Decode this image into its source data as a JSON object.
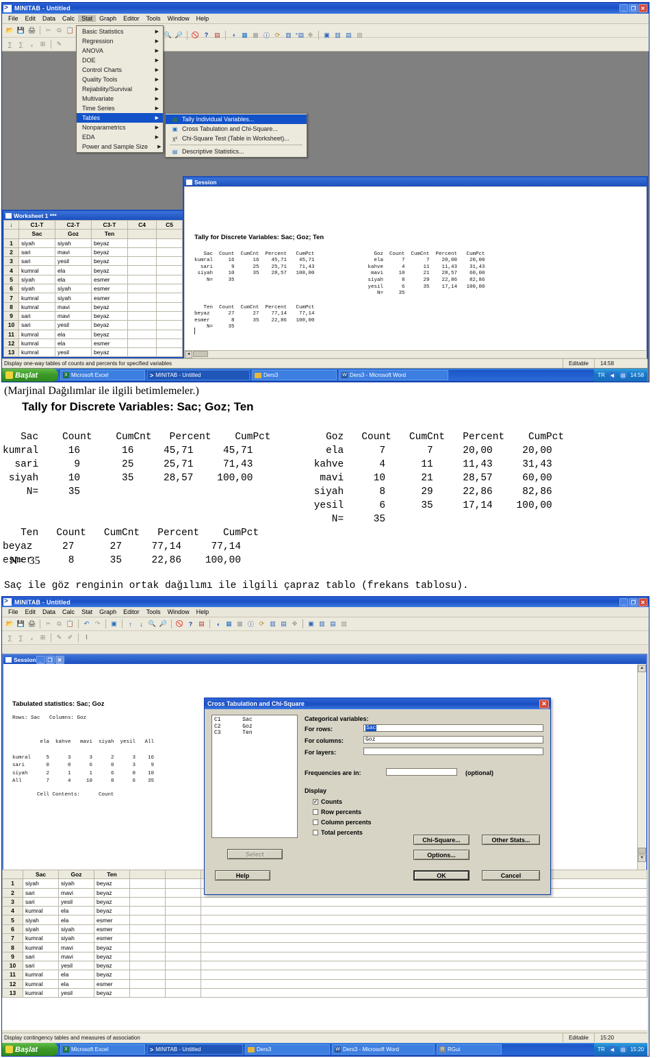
{
  "screenshot1": {
    "window": {
      "title": "MINITAB - Untitled",
      "min": "_",
      "max": "❐",
      "close": "✕"
    },
    "menubar": [
      "File",
      "Edit",
      "Data",
      "Calc",
      "Stat",
      "Graph",
      "Editor",
      "Tools",
      "Window",
      "Help"
    ],
    "stat_menu": {
      "items": [
        {
          "label": "Basic Statistics",
          "arrow": "▶"
        },
        {
          "label": "Regression",
          "arrow": "▶"
        },
        {
          "label": "ANOVA",
          "arrow": "▶"
        },
        {
          "label": "DOE",
          "arrow": "▶"
        },
        {
          "label": "Control Charts",
          "arrow": "▶"
        },
        {
          "label": "Quality Tools",
          "arrow": "▶"
        },
        {
          "label": "Rejiability/Survival",
          "arrow": "▶"
        },
        {
          "label": "Multivariate",
          "arrow": "▶"
        },
        {
          "label": "Time Series",
          "arrow": "▶"
        },
        {
          "label": "Tables",
          "arrow": "▶",
          "selected": true
        },
        {
          "label": "Nonparametrics",
          "arrow": "▶"
        },
        {
          "label": "EDA",
          "arrow": "▶"
        },
        {
          "label": "Power and Sample Size",
          "arrow": "▶"
        }
      ]
    },
    "tables_submenu": {
      "items": [
        {
          "label": "Tally Individual Variables...",
          "icon": "grid-icon",
          "selected": true
        },
        {
          "label": "Cross Tabulation and Chi-Square...",
          "icon": "crosstab-icon",
          "selected": false
        },
        {
          "label": "Chi-Square Test (Table in Worksheet)...",
          "icon": "chi-square-icon",
          "selected": false
        },
        {
          "label": "Descriptive Statistics...",
          "icon": "table-icon",
          "selected": false
        }
      ]
    },
    "session": {
      "title": "Session",
      "heading": "Tally for Discrete Variables: Sac; Goz; Ten",
      "table_sac": {
        "headers": [
          "Sac",
          "Count",
          "CumCnt",
          "Percent",
          "CumPct"
        ],
        "rows": [
          [
            "kumral",
            "16",
            "16",
            "45,71",
            "45,71"
          ],
          [
            "sari",
            "9",
            "25",
            "25,71",
            "71,43"
          ],
          [
            "siyah",
            "10",
            "35",
            "28,57",
            "100,00"
          ],
          [
            "N=",
            "35",
            "",
            "",
            ""
          ]
        ]
      },
      "table_goz": {
        "headers": [
          "Goz",
          "Count",
          "CumCnt",
          "Percent",
          "CumPct"
        ],
        "rows": [
          [
            "ela",
            "7",
            "7",
            "20,00",
            "20,00"
          ],
          [
            "kahve",
            "4",
            "11",
            "11,43",
            "31,43"
          ],
          [
            "mavi",
            "10",
            "21",
            "28,57",
            "60,00"
          ],
          [
            "siyah",
            "8",
            "29",
            "22,86",
            "82,86"
          ],
          [
            "yesil",
            "6",
            "35",
            "17,14",
            "100,00"
          ],
          [
            "N=",
            "35",
            "",
            "",
            ""
          ]
        ]
      },
      "table_ten": {
        "headers": [
          "Ten",
          "Count",
          "CumCnt",
          "Percent",
          "CumPct"
        ],
        "rows": [
          [
            "beyaz",
            "27",
            "27",
            "77,14",
            "77,14"
          ],
          [
            "esmer",
            "8",
            "35",
            "22,86",
            "100,00"
          ],
          [
            "N=",
            "35",
            "",
            "",
            ""
          ]
        ]
      }
    },
    "worksheet": {
      "title": "Worksheet 1 ***",
      "col_ids": [
        "↓",
        "C1-T",
        "C2-T",
        "C3-T",
        "C4",
        "C5"
      ],
      "col_names": [
        "",
        "Sac",
        "Goz",
        "Ten",
        "",
        ""
      ],
      "rows": [
        [
          "1",
          "siyah",
          "siyah",
          "beyaz",
          "",
          ""
        ],
        [
          "2",
          "sari",
          "mavi",
          "beyaz",
          "",
          ""
        ],
        [
          "3",
          "sari",
          "yesil",
          "beyaz",
          "",
          ""
        ],
        [
          "4",
          "kumral",
          "ela",
          "beyaz",
          "",
          ""
        ],
        [
          "5",
          "siyah",
          "ela",
          "esmer",
          "",
          ""
        ],
        [
          "6",
          "siyah",
          "siyah",
          "esmer",
          "",
          ""
        ],
        [
          "7",
          "kumral",
          "siyah",
          "esmer",
          "",
          ""
        ],
        [
          "8",
          "kumral",
          "mavi",
          "beyaz",
          "",
          ""
        ],
        [
          "9",
          "sari",
          "mavi",
          "beyaz",
          "",
          ""
        ],
        [
          "10",
          "sari",
          "yesil",
          "beyaz",
          "",
          ""
        ],
        [
          "11",
          "kumral",
          "ela",
          "beyaz",
          "",
          ""
        ],
        [
          "12",
          "kumral",
          "ela",
          "esmer",
          "",
          ""
        ],
        [
          "13",
          "kumral",
          "yesil",
          "beyaz",
          "",
          ""
        ]
      ]
    },
    "statusbar": {
      "message": "Display one-way tables of counts and percents for specified variables",
      "editable": "Editable",
      "time": "14:58"
    },
    "taskbar": {
      "start": "Başlat",
      "tasks": [
        {
          "label": "Microsoft Excel",
          "icon": "excel-icon",
          "active": false
        },
        {
          "label": "MINITAB - Untitled",
          "icon": "minitab-icon",
          "active": true
        },
        {
          "label": "Ders3",
          "icon": "folder-icon",
          "active": false
        },
        {
          "label": "Ders3 - Microsoft Word",
          "icon": "word-icon",
          "active": false
        }
      ],
      "lang": "TR",
      "time": "14:58"
    }
  },
  "document": {
    "caption1": "(Marjinal Dağılımlar ile ilgili betimlemeler.)",
    "heading1": "Tally for Discrete Variables: Sac; Goz; Ten",
    "caption2": "Saç ile göz renginin ortak dağılımı ile ilgili çapraz tablo (frekans tablosu)."
  },
  "screenshot2": {
    "window": {
      "title": "MINITAB - Untitled",
      "min": "_",
      "max": "❐",
      "close": "✕"
    },
    "menubar": [
      "File",
      "Edit",
      "Data",
      "Calc",
      "Stat",
      "Graph",
      "Editor",
      "Tools",
      "Window",
      "Help"
    ],
    "session": {
      "title": "Session",
      "heading": "Tabulated statistics: Sac; Goz",
      "rowscols": "Rows: Sac   Columns: Goz",
      "cell_contents_label": "Cell Contents:",
      "cell_contents_value": "Count"
    },
    "worksheet": {
      "col_names": [
        "",
        "Sac",
        "Goz",
        "Ten",
        "",
        ""
      ],
      "rows": [
        [
          "1",
          "siyah",
          "siyah",
          "beyaz",
          "",
          ""
        ],
        [
          "2",
          "sari",
          "mavi",
          "beyaz",
          "",
          ""
        ],
        [
          "3",
          "sari",
          "yesil",
          "beyaz",
          "",
          ""
        ],
        [
          "4",
          "kumral",
          "ela",
          "beyaz",
          "",
          ""
        ],
        [
          "5",
          "siyah",
          "ela",
          "esmer",
          "",
          ""
        ],
        [
          "6",
          "siyah",
          "siyah",
          "esmer",
          "",
          ""
        ],
        [
          "7",
          "kumral",
          "siyah",
          "esmer",
          "",
          ""
        ],
        [
          "8",
          "kumral",
          "mavi",
          "beyaz",
          "",
          ""
        ],
        [
          "9",
          "sari",
          "mavi",
          "beyaz",
          "",
          ""
        ],
        [
          "10",
          "sari",
          "yesil",
          "beyaz",
          "",
          ""
        ],
        [
          "11",
          "kumral",
          "ela",
          "beyaz",
          "",
          ""
        ],
        [
          "12",
          "kumral",
          "ela",
          "esmer",
          "",
          ""
        ],
        [
          "13",
          "kumral",
          "yesil",
          "beyaz",
          "",
          ""
        ]
      ]
    },
    "dialog": {
      "title": "Cross Tabulation and Chi-Square",
      "close": "✕",
      "variables": [
        {
          "id": "C1",
          "name": "Sac"
        },
        {
          "id": "C2",
          "name": "Goz"
        },
        {
          "id": "C3",
          "name": "Ten"
        }
      ],
      "section_label": "Categorical variables:",
      "for_rows_label": "For rows:",
      "for_rows_value": "Sac",
      "for_columns_label": "For columns:",
      "for_columns_value": "Goz",
      "for_layers_label": "For layers:",
      "for_layers_value": "",
      "frequencies_label": "Frequencies are in:",
      "frequencies_value": "",
      "optional_label": "(optional)",
      "display_label": "Display",
      "checkboxes": [
        {
          "label": "Counts",
          "checked": true
        },
        {
          "label": "Row percents",
          "checked": false
        },
        {
          "label": "Column percents",
          "checked": false
        },
        {
          "label": "Total percents",
          "checked": false
        }
      ],
      "buttons": {
        "chi_square": "Chi-Square...",
        "other_stats": "Other Stats...",
        "options": "Options...",
        "select": "Select",
        "help": "Help",
        "ok": "OK",
        "cancel": "Cancel"
      }
    },
    "statusbar": {
      "message": "Display contingency tables and measures of association",
      "editable": "Editable",
      "time": "15:20"
    },
    "taskbar": {
      "start": "Başlat",
      "tasks": [
        {
          "label": "Microsoft Excel",
          "icon": "excel-icon",
          "active": false
        },
        {
          "label": "MINITAB - Untitled",
          "icon": "minitab-icon",
          "active": true
        },
        {
          "label": "Ders3",
          "icon": "folder-icon",
          "active": false
        },
        {
          "label": "Ders3 - Microsoft Word",
          "icon": "word-icon",
          "active": false
        },
        {
          "label": "RGui",
          "icon": "r-icon",
          "active": false
        }
      ],
      "lang": "TR",
      "time": "15:20"
    }
  },
  "chart_data": {
    "type": "table",
    "title": "Tabulated statistics: Sac; Goz",
    "subtitle": "Rows: Sac   Columns: Goz",
    "row_variable": "Sac",
    "column_variable": "Goz",
    "categories": [
      "ela",
      "kahve",
      "mavi",
      "siyah",
      "yesil",
      "All"
    ],
    "rows": [
      {
        "name": "kumral",
        "values": [
          5,
          3,
          3,
          2,
          3,
          16
        ]
      },
      {
        "name": "sari",
        "values": [
          0,
          0,
          6,
          0,
          3,
          9
        ]
      },
      {
        "name": "siyah",
        "values": [
          2,
          1,
          1,
          6,
          0,
          10
        ]
      },
      {
        "name": "All",
        "values": [
          7,
          4,
          10,
          8,
          6,
          35
        ]
      }
    ],
    "cell_contents": "Count",
    "n": 35
  }
}
